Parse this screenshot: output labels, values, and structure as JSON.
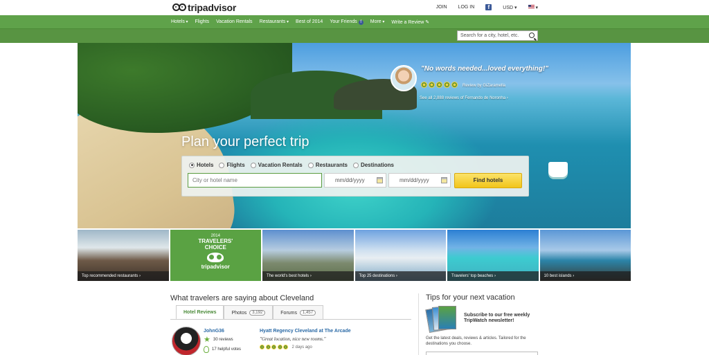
{
  "header": {
    "logo_text": "tripadvisor",
    "links": [
      "JOIN",
      "LOG IN"
    ],
    "currency": "USD"
  },
  "nav": {
    "items": [
      "Hotels",
      "Flights",
      "Vacation Rentals",
      "Restaurants",
      "Best of 2014",
      "Your Friends",
      "More",
      "Write a Review"
    ],
    "search_placeholder": "Search for a city, hotel, etc."
  },
  "hero": {
    "quote": "\"No words needed...loved everything!\"",
    "review_by": "Review by GiZaramella",
    "see_all": "See all 2,888 reviews of Fernando de Noronha",
    "rating_dots": 5,
    "title": "Plan your perfect trip",
    "options": [
      "Hotels",
      "Flights",
      "Vacation Rentals",
      "Restaurants",
      "Destinations"
    ],
    "selected_option": "Hotels",
    "city_placeholder": "City or hotel name",
    "checkin_placeholder": "mm/dd/yyyy",
    "checkout_placeholder": "mm/dd/yyyy",
    "find_button": "Find hotels"
  },
  "tiles": {
    "t1": "Top recommended restaurants",
    "badge_year": "2014",
    "badge_line1": "TRAVELERS'",
    "badge_line2": "CHOICE",
    "badge_brand": "tripadvisor",
    "t3": "The world's best hotels",
    "t4": "Top 25 destinations",
    "t5": "Travelers' top beaches",
    "t6": "10 best islands"
  },
  "reviews": {
    "title": "What travelers are saying about Cleveland",
    "tabs": [
      {
        "label": "Hotel Reviews",
        "count": ""
      },
      {
        "label": "Photos",
        "count": "3,192"
      },
      {
        "label": "Forums",
        "count": "1,457"
      }
    ],
    "reviewer_name": "JohnG36",
    "reviewer_reviews": "30 reviews",
    "reviewer_helpful": "17 helpful votes",
    "hotel_name": "Hyatt Regency Cleveland at The Arcade",
    "hotel_quote": "\"Great location, nice new rooms.\"",
    "hotel_when": "2 days ago",
    "hotel_rating": 5
  },
  "tips": {
    "title": "Tips for your next vacation",
    "subscribe": "Subscribe to our free weekly TripWatch newsletter!",
    "desc": "Get the latest deals, reviews & articles. Tailored for the destinations you choose."
  },
  "colors": {
    "brand_green": "#589442",
    "button_yellow": "#f2c51a",
    "link_blue": "#2b6aa6"
  }
}
